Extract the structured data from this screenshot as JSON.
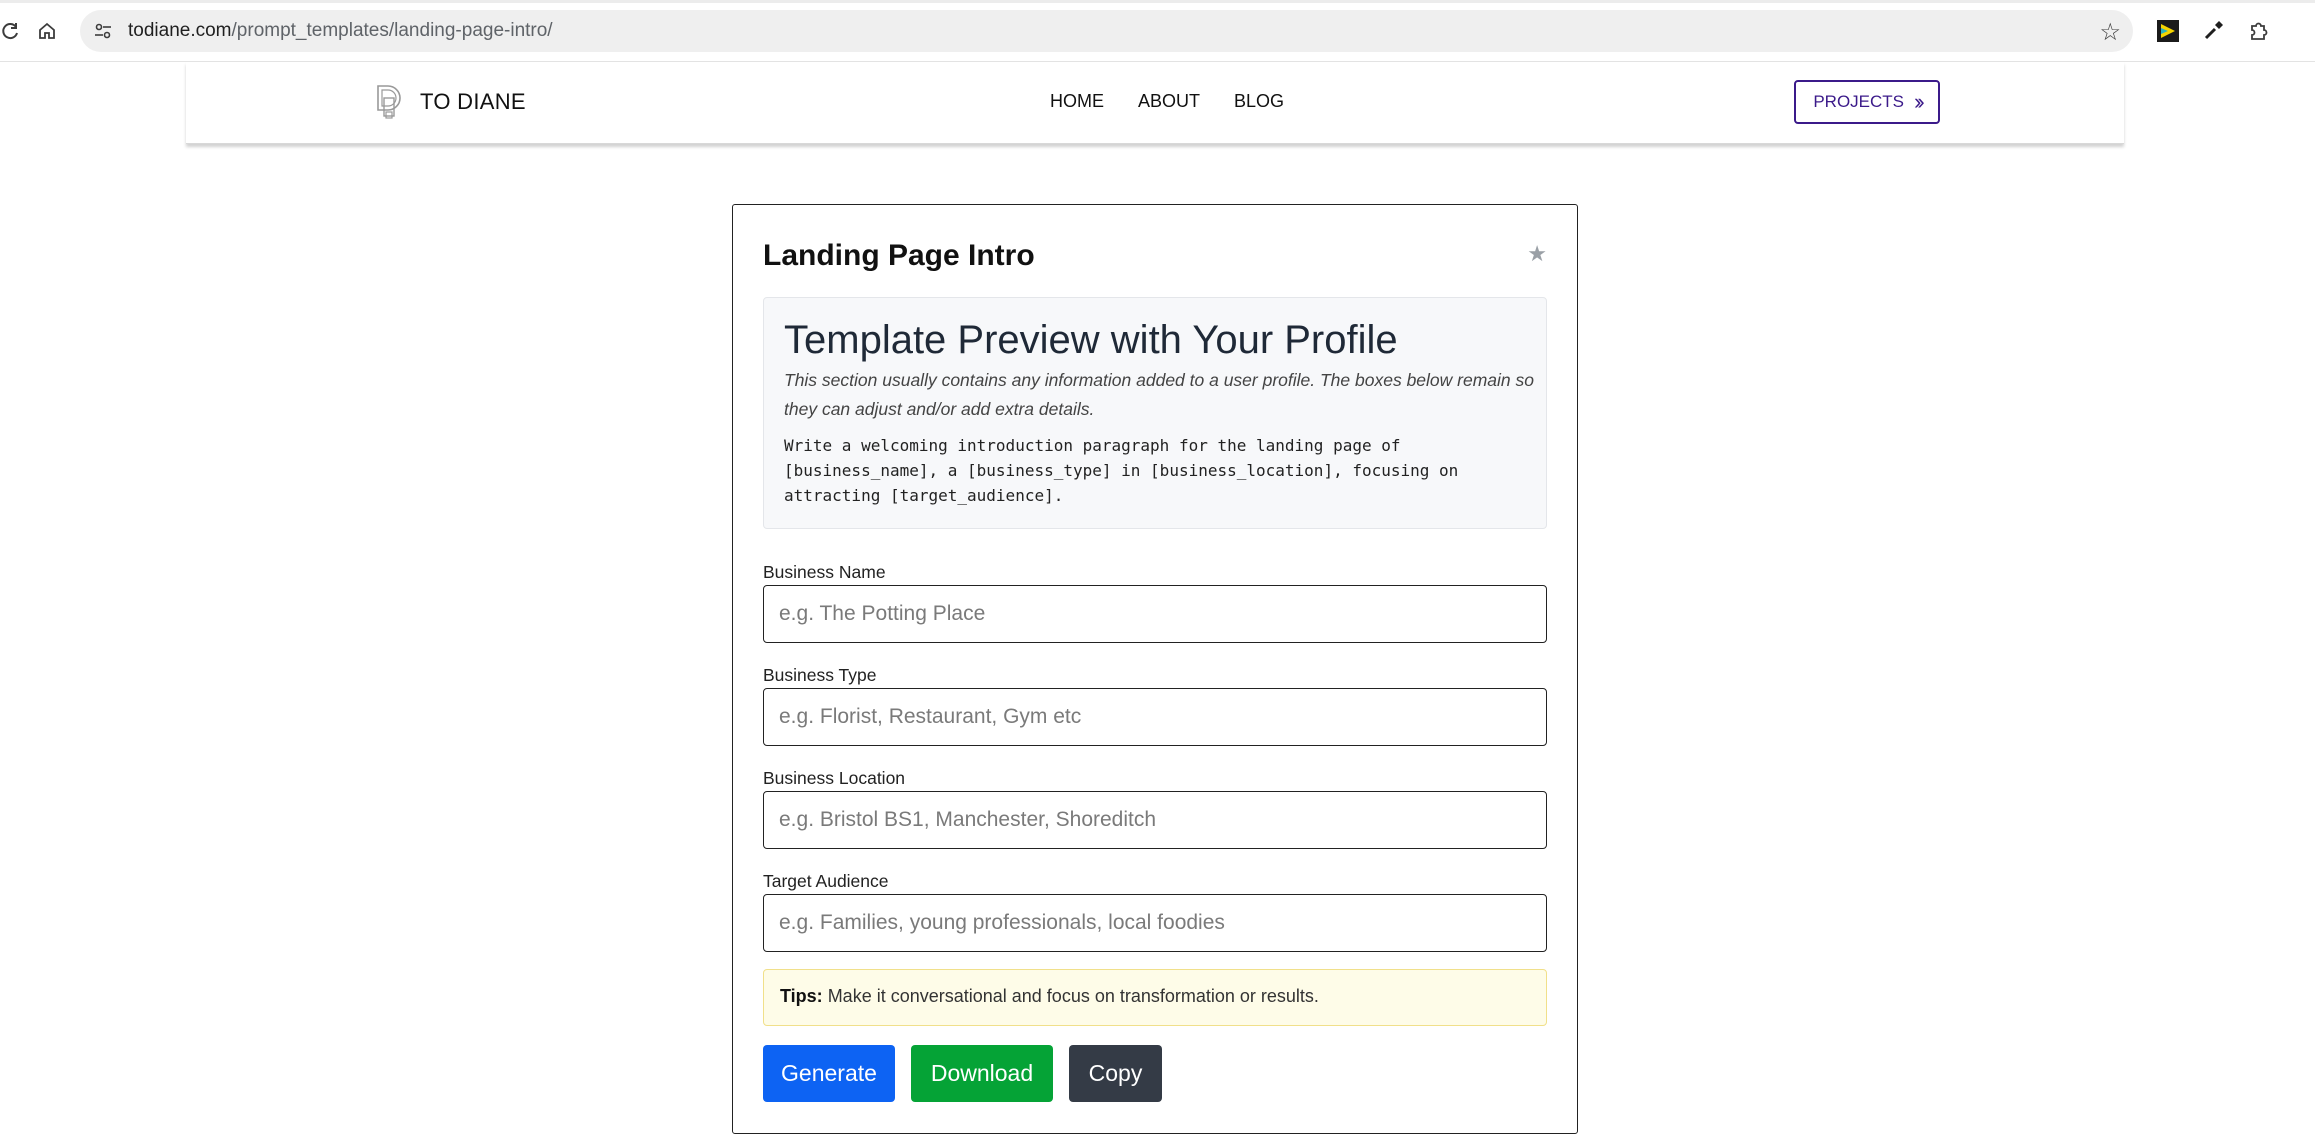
{
  "browser": {
    "url_domain": "todiane.com",
    "url_path": "/prompt_templates/landing-page-intro/",
    "icons": [
      "reload-icon",
      "home-icon",
      "site-info-icon",
      "bookmark-star-icon",
      "extension-icon",
      "eyedropper-icon",
      "puzzle-extensions-icon"
    ]
  },
  "nav": {
    "brand": "TO DIANE",
    "links": [
      "HOME",
      "ABOUT",
      "BLOG"
    ],
    "projects_label": "PROJECTS",
    "accent_color": "#3b1a8a"
  },
  "card": {
    "title": "Landing Page Intro",
    "preview": {
      "heading": "Template Preview with Your Profile",
      "note": "This section usually contains any information added to a user profile. The boxes below remain so they can adjust and/or add extra details.",
      "prompt": "Write a welcoming introduction paragraph for the landing page of\n[business_name], a [business_type] in [business_location], focusing on\nattracting [target_audience]."
    },
    "fields": [
      {
        "label": "Business Name",
        "placeholder": "e.g. The Potting Place"
      },
      {
        "label": "Business Type",
        "placeholder": "e.g. Florist, Restaurant, Gym etc"
      },
      {
        "label": "Business Location",
        "placeholder": "e.g. Bristol BS1, Manchester, Shoreditch"
      },
      {
        "label": "Target Audience",
        "placeholder": "e.g. Families, young professionals, local foodies"
      }
    ],
    "tips_label": "Tips:",
    "tips_text": "Make it conversational and focus on transformation or results.",
    "buttons": {
      "generate": "Generate",
      "download": "Download",
      "copy": "Copy"
    },
    "colors": {
      "generate": "#0d63f3",
      "download": "#05a336",
      "copy": "#343b46"
    }
  }
}
